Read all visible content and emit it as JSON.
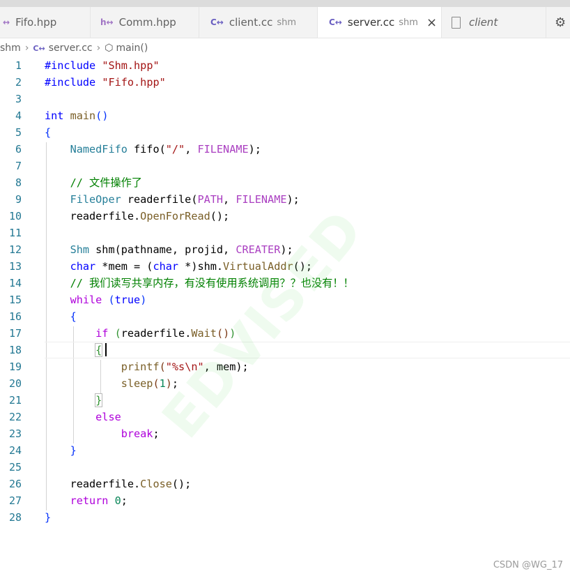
{
  "tabs": [
    {
      "icon": "hpp-file-icon",
      "icon_glyph": "↔",
      "label": "Fifo.hpp",
      "desc": "",
      "active": false
    },
    {
      "icon": "hpp-file-icon",
      "icon_glyph": "h↔",
      "label": "Comm.hpp",
      "desc": "",
      "active": false
    },
    {
      "icon": "cpp-file-icon",
      "icon_glyph": "C↔",
      "label": "client.cc",
      "desc": "shm",
      "active": false
    },
    {
      "icon": "cpp-file-icon",
      "icon_glyph": "C↔",
      "label": "server.cc",
      "desc": "shm",
      "active": true,
      "close": "×"
    },
    {
      "icon": "file-icon",
      "icon_glyph": "",
      "label": "client",
      "desc": "",
      "active": false
    }
  ],
  "breadcrumb": {
    "folder": "shm",
    "file_icon": "C↔",
    "file": "server.cc",
    "symbol": "main()"
  },
  "code": {
    "lines": [
      "1",
      "2",
      "3",
      "4",
      "5",
      "6",
      "7",
      "8",
      "9",
      "10",
      "11",
      "12",
      "13",
      "14",
      "15",
      "16",
      "17",
      "18",
      "19",
      "20",
      "21",
      "22",
      "23",
      "24",
      "25",
      "26",
      "27",
      "28"
    ],
    "l1_include": "#include",
    "l1_str": "\"Shm.hpp\"",
    "l2_include": "#include",
    "l2_str": "\"Fifo.hpp\"",
    "l4_int": "int",
    "l4_main": "main",
    "l4_parens": "()",
    "l5": "{",
    "l6_type": "NamedFifo",
    "l6_var": " fifo(",
    "l6_str": "\"/\"",
    "l6_mid": ", ",
    "l6_mac": "FILENAME",
    "l6_end": ");",
    "l8_comment": "// 文件操作了",
    "l9_type": "FileOper",
    "l9_var": " readerfile(",
    "l9_mac1": "PATH",
    "l9_mid": ", ",
    "l9_mac2": "FILENAME",
    "l9_end": ");",
    "l10_obj": "readerfile.",
    "l10_fn": "OpenForRead",
    "l10_end": "();",
    "l12_type": "Shm",
    "l12_var": " shm(pathname, projid, ",
    "l12_mac": "CREATER",
    "l12_end": ");",
    "l13_char": "char",
    "l13_mid": " *mem = (",
    "l13_char2": "char",
    "l13_mid2": " *)shm.",
    "l13_fn": "VirtualAddr",
    "l13_end": "();",
    "l14_comment": "// 我们读写共享内存，有没有使用系统调用？？也没有！！",
    "l15_while": "while",
    "l15_true": "true",
    "l16": "{",
    "l17_if": "if",
    "l17_obj": "readerfile.",
    "l17_fn": "Wait",
    "l18": "{",
    "l19_fn": "printf",
    "l19_str": "\"%s\\n\"",
    "l19_end": ", mem);",
    "l20_fn": "sleep",
    "l20_num": "1",
    "l20_end": ";",
    "l21": "}",
    "l22_else": "else",
    "l23_break": "break",
    "l23_end": ";",
    "l24": "}",
    "l26_obj": "readerfile.",
    "l26_fn": "Close",
    "l26_end": "();",
    "l27_return": "return",
    "l27_num": "0",
    "l27_end": ";",
    "l28": "}"
  },
  "watermark": "EDVISED",
  "credit": "CSDN @WG_17"
}
